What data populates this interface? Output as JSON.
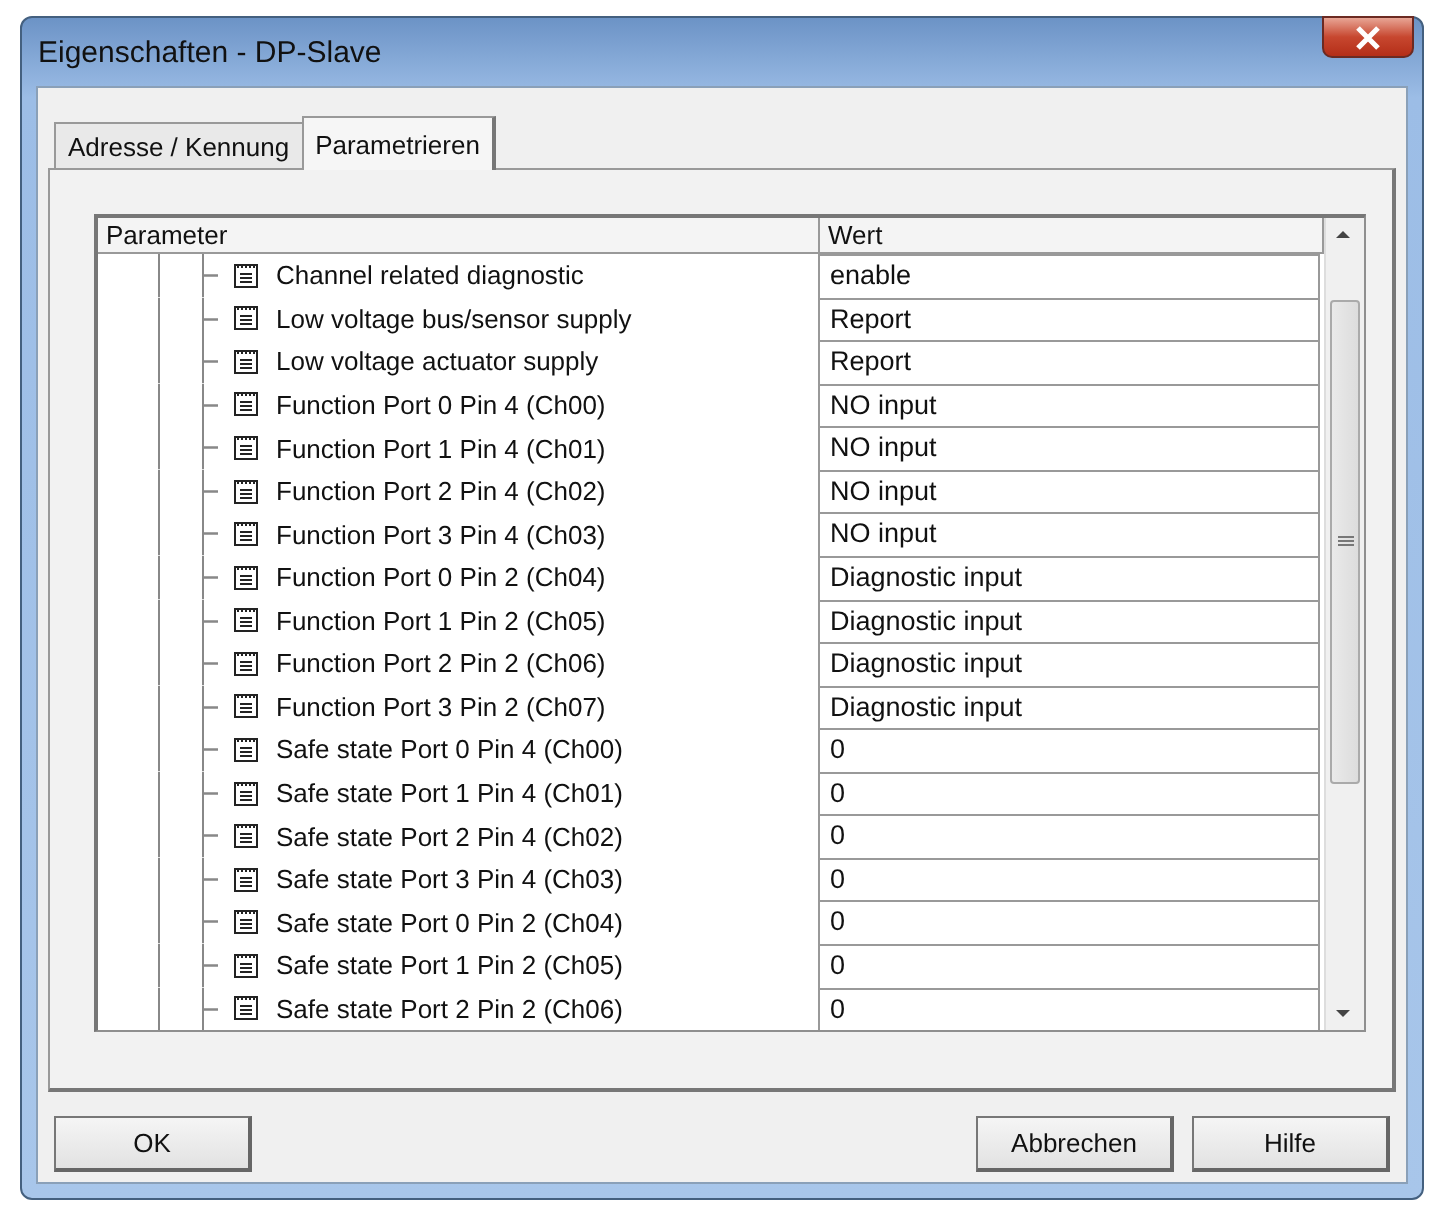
{
  "window": {
    "title": "Eigenschaften - DP-Slave"
  },
  "tabs": [
    {
      "label": "Adresse / Kennung",
      "selected": false
    },
    {
      "label": "Parametrieren",
      "selected": true
    }
  ],
  "table": {
    "columns": [
      "Parameter",
      "Wert"
    ],
    "rows": [
      {
        "parameter": "Channel related diagnostic",
        "value": "enable"
      },
      {
        "parameter": "Low voltage bus/sensor supply",
        "value": "Report"
      },
      {
        "parameter": "Low voltage actuator supply",
        "value": "Report"
      },
      {
        "parameter": "Function Port 0 Pin 4 (Ch00)",
        "value": "NO input"
      },
      {
        "parameter": "Function Port 1 Pin 4 (Ch01)",
        "value": "NO input"
      },
      {
        "parameter": "Function Port 2 Pin 4 (Ch02)",
        "value": "NO input"
      },
      {
        "parameter": "Function Port 3 Pin 4 (Ch03)",
        "value": "NO input"
      },
      {
        "parameter": "Function Port 0 Pin 2 (Ch04)",
        "value": "Diagnostic input"
      },
      {
        "parameter": "Function Port 1 Pin 2 (Ch05)",
        "value": "Diagnostic input"
      },
      {
        "parameter": "Function Port 2 Pin 2 (Ch06)",
        "value": "Diagnostic input"
      },
      {
        "parameter": "Function Port 3 Pin 2 (Ch07)",
        "value": "Diagnostic input"
      },
      {
        "parameter": "Safe state Port 0 Pin 4 (Ch00)",
        "value": "0"
      },
      {
        "parameter": "Safe state Port 1 Pin 4 (Ch01)",
        "value": "0"
      },
      {
        "parameter": "Safe state Port 2 Pin 4 (Ch02)",
        "value": "0"
      },
      {
        "parameter": "Safe state Port 3 Pin 4 (Ch03)",
        "value": "0"
      },
      {
        "parameter": "Safe state Port 0 Pin 2 (Ch04)",
        "value": "0"
      },
      {
        "parameter": "Safe state Port 1 Pin 2 (Ch05)",
        "value": "0"
      },
      {
        "parameter": "Safe state Port 2 Pin 2 (Ch06)",
        "value": "0"
      }
    ]
  },
  "buttons": {
    "left": [
      "OK"
    ],
    "right": [
      "Abbrechen",
      "Hilfe"
    ]
  }
}
